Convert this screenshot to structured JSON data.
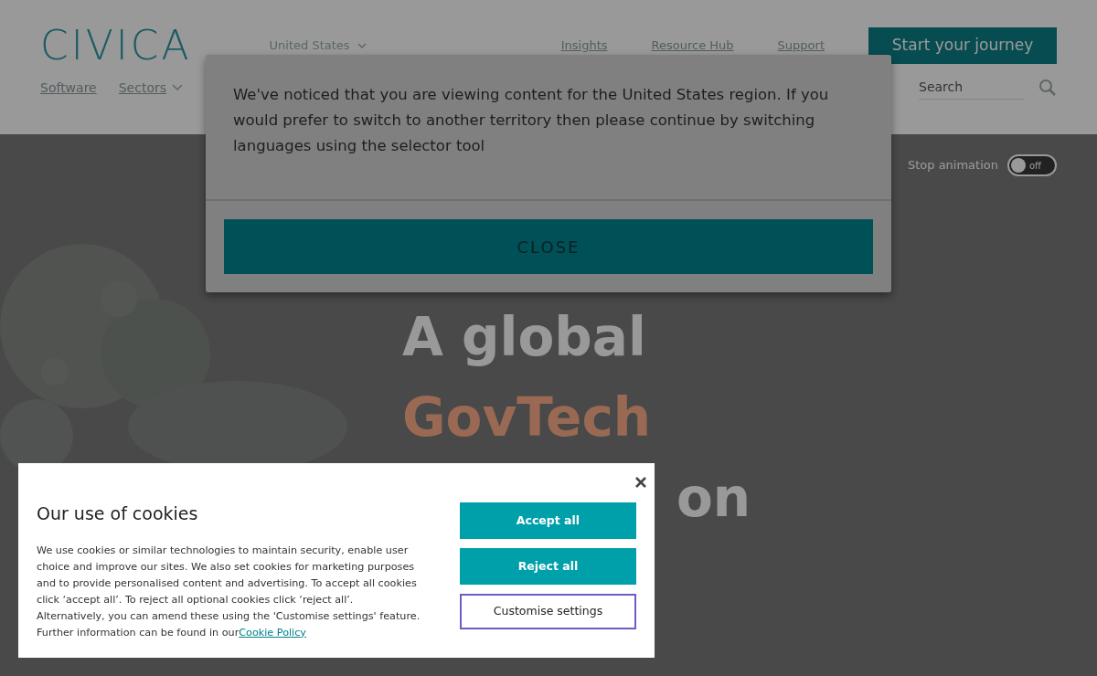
{
  "header": {
    "logo": "CIVICA",
    "region_selector": "United States",
    "links": [
      "Insights",
      "Resource Hub",
      "Support"
    ],
    "cta": "Start your journey",
    "nav": [
      {
        "label": "Software",
        "has_menu": false
      },
      {
        "label": "Sectors",
        "has_menu": true
      }
    ],
    "search": {
      "placeholder": "Search"
    }
  },
  "hero": {
    "animation_toggle": {
      "label": "Stop animation",
      "state_text": "off",
      "on": false
    },
    "headline": [
      {
        "text": "A global",
        "kind": "plain"
      },
      {
        "text": "GovTech",
        "kind": "accent"
      },
      {
        "text": "on",
        "kind": "plain"
      }
    ]
  },
  "region_modal": {
    "message": "We've noticed that you are viewing content for the United States region. If you would prefer to switch to another territory then please continue by switching languages using the selector tool",
    "button": "CLOSE"
  },
  "cookie_banner": {
    "title": "Our use of cookies",
    "text": "We use cookies or similar technologies to maintain security, enable user choice and improve our sites. We also set cookies for marketing purposes and to provide personalised content and advertising. To accept all cookies click ‘accept all’. To reject all optional cookies click ‘reject all’. Alternatively, you can amend these using the 'Customise settings' feature. Further information can be found in our",
    "link": "Cookie Policy",
    "buttons": [
      {
        "label": "Accept all",
        "kind": "primary"
      },
      {
        "label": "Reject all",
        "kind": "primary"
      },
      {
        "label": "Customise settings",
        "kind": "outline"
      }
    ]
  }
}
